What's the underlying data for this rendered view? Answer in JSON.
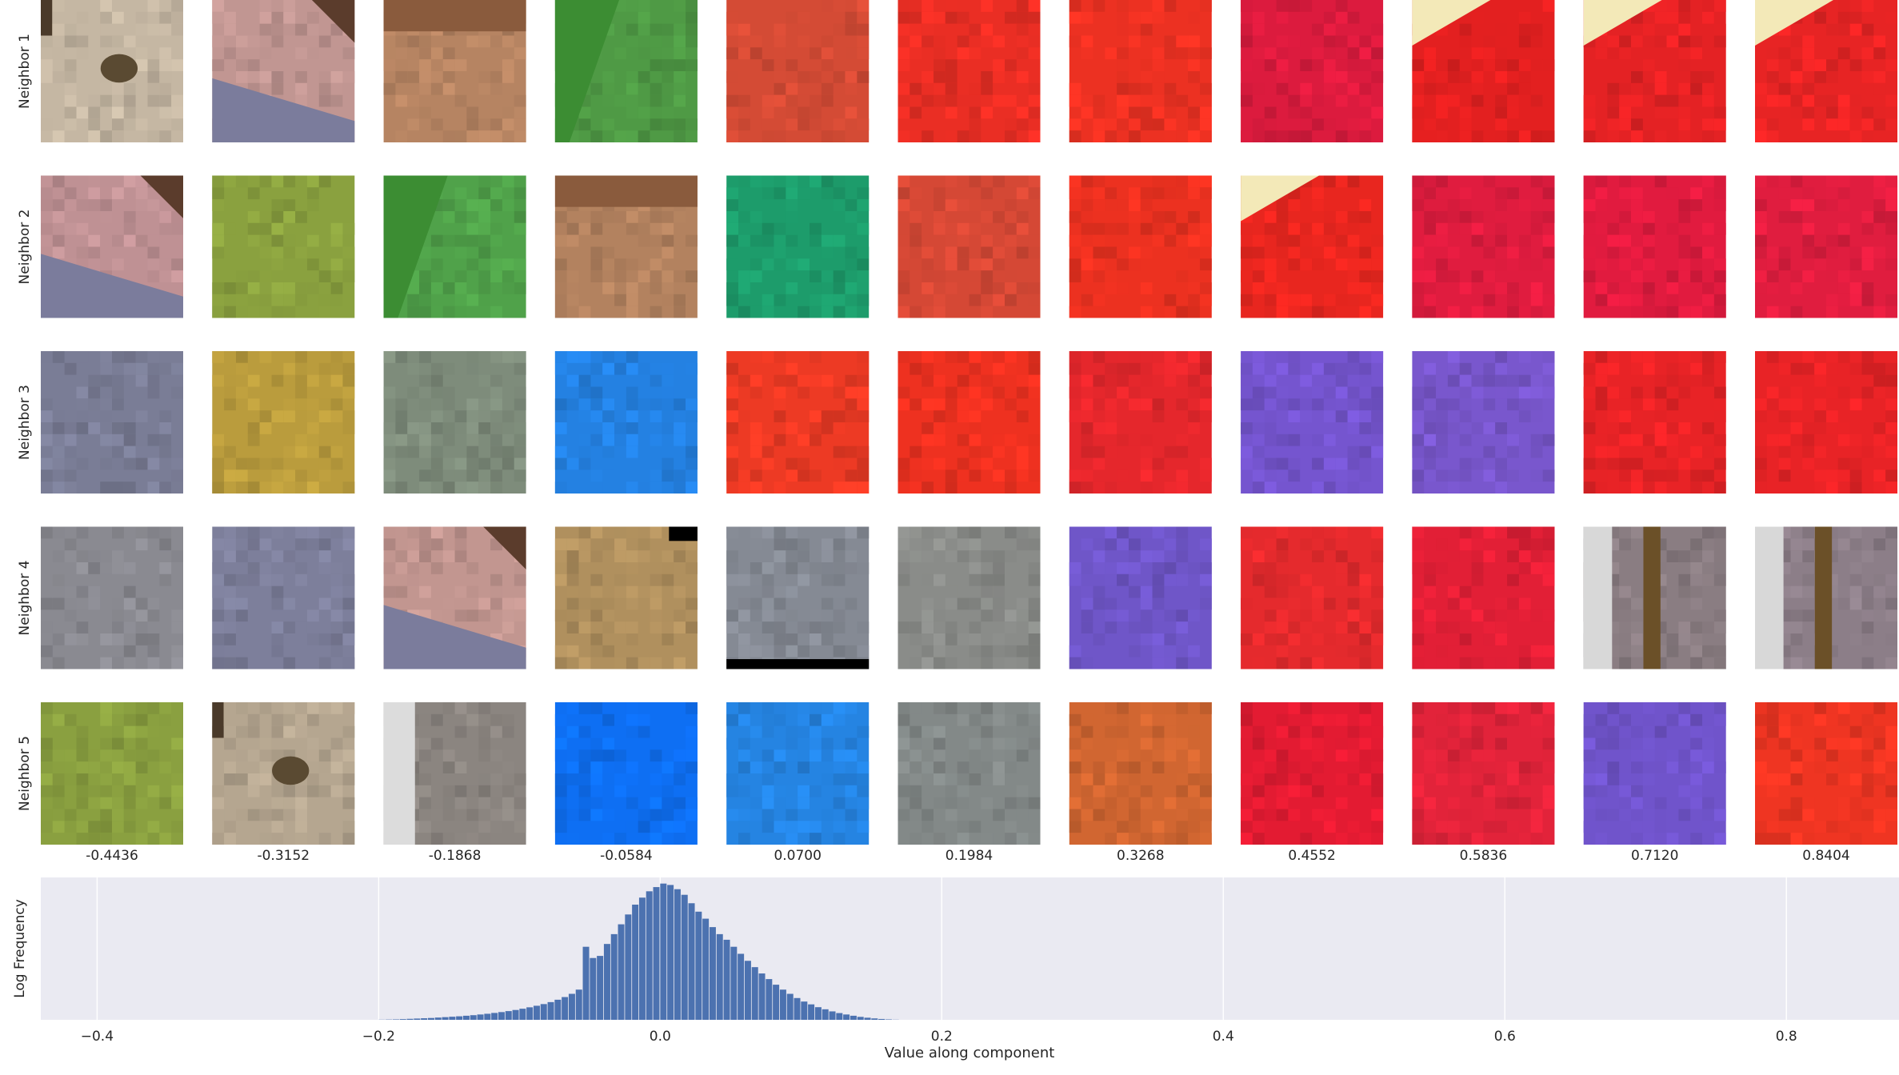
{
  "chart_data": [
    {
      "type": "image-grid",
      "row_labels": [
        "Neighbor 1",
        "Neighbor 2",
        "Neighbor 3",
        "Neighbor 4",
        "Neighbor 5"
      ],
      "column_values": [
        "-0.4436",
        "-0.3152",
        "-0.1868",
        "-0.0584",
        "0.0700",
        "0.1984",
        "0.3268",
        "0.4552",
        "0.5836",
        "0.7120",
        "0.8404"
      ],
      "patch_colors": [
        [
          "#c5b7a3",
          "#c19692",
          "#b68462",
          "#4f9a45",
          "#d44b35",
          "#ea2e24",
          "#ec3122",
          "#dc1b3e",
          "#e32020",
          "#e42224",
          "#e72424"
        ],
        [
          "#bf9194",
          "#8aa13f",
          "#50a24a",
          "#b3825f",
          "#1d9c6b",
          "#d54835",
          "#ec3120",
          "#e8261f",
          "#e01c3f",
          "#e11b3f",
          "#e01d3f"
        ],
        [
          "#7a7d96",
          "#ba9c3d",
          "#7e8c7b",
          "#2481e2",
          "#ed3a24",
          "#ee3120",
          "#e5272c",
          "#7555cf",
          "#7957cd",
          "#e82326",
          "#e82326"
        ],
        [
          "#8a8a91",
          "#7d7f9b",
          "#c29690",
          "#b0905e",
          "#858a94",
          "#8a8c89",
          "#6f56c8",
          "#e52a2d",
          "#e21f36",
          "#8a7d82",
          "#8c7e88"
        ],
        [
          "#8aa040",
          "#b5a690",
          "#8b8580",
          "#0e6ff3",
          "#2584e2",
          "#838988",
          "#d16631",
          "#e31b32",
          "#e2233a",
          "#7054cb",
          "#ef3522"
        ]
      ],
      "patch_detail": [
        [
          "eye",
          "skin-cloth",
          "tan-band",
          "green-diagonal",
          "plain",
          "plain",
          "plain",
          "plain",
          "cream-corner",
          "cream-corner",
          "cream-corner"
        ],
        [
          "skin-cloth",
          "plain",
          "green-diagonal",
          "tan-band",
          "plain",
          "plain",
          "plain",
          "cream-corner",
          "plain",
          "plain",
          "plain"
        ],
        [
          "plain",
          "plain",
          "plain",
          "plain",
          "plain",
          "plain",
          "plain",
          "plain",
          "plain",
          "plain",
          "plain"
        ],
        [
          "plain",
          "plain",
          "skin-cloth",
          "black-corner",
          "black-bottom",
          "plain",
          "plain",
          "plain",
          "plain",
          "stripes",
          "stripes"
        ],
        [
          "plain",
          "eye",
          "white-left",
          "plain",
          "plain",
          "plain",
          "plain",
          "plain",
          "plain",
          "plain",
          "plain"
        ]
      ]
    },
    {
      "type": "bar",
      "xlabel": "Value along component",
      "ylabel": "Log Frequency",
      "xlim": [
        -0.44,
        0.88
      ],
      "xticks": [
        -0.4,
        -0.2,
        0.0,
        0.2,
        0.4,
        0.6,
        0.8
      ],
      "xtick_labels": [
        "−0.4",
        "−0.2",
        "0.0",
        "0.2",
        "0.4",
        "0.6",
        "0.8"
      ],
      "bar_color": "#4c72b0",
      "background": "#eaeaf2",
      "grid": true,
      "bin_start": -0.2,
      "bin_width": 0.005,
      "log_counts": [
        0.1,
        0.2,
        0.3,
        0.5,
        0.7,
        0.9,
        1.1,
        1.3,
        1.6,
        1.9,
        2.2,
        2.5,
        2.9,
        3.3,
        3.8,
        4.3,
        4.9,
        5.5,
        6.2,
        7.0,
        7.9,
        8.9,
        10.0,
        11.2,
        12.6,
        14.3,
        16.2,
        18.5,
        21.5,
        52.0,
        44.0,
        45.5,
        54.0,
        61.0,
        68.0,
        75.0,
        82.0,
        87.0,
        91.5,
        94.5,
        97.0,
        96.0,
        93.0,
        89.0,
        83.0,
        77.0,
        72.0,
        66.0,
        61.0,
        57.0,
        52.0,
        47.0,
        42.0,
        37.5,
        33.0,
        29.0,
        25.0,
        21.5,
        18.5,
        15.5,
        13.0,
        11.0,
        9.0,
        7.5,
        6.0,
        4.8,
        3.8,
        2.9,
        2.1,
        1.5,
        1.0,
        0.6,
        0.3,
        0.1
      ]
    }
  ]
}
